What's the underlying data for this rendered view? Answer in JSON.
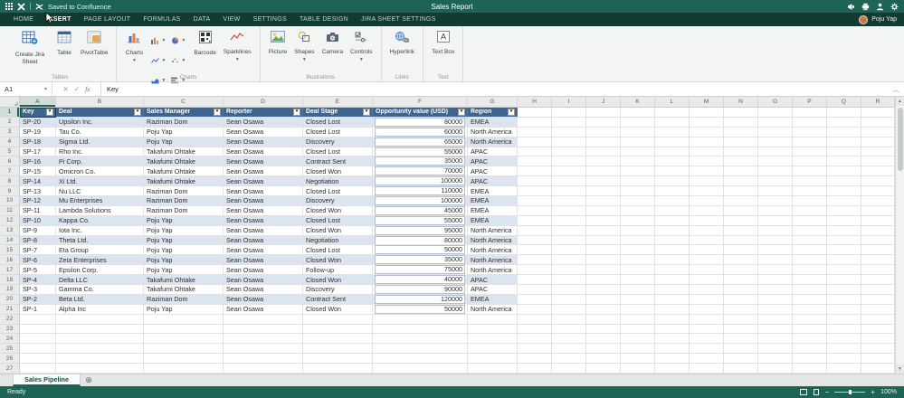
{
  "colors": {
    "chrome": "#1e6455",
    "chrome_dark": "#123b32",
    "table_header": "#3d6591",
    "band_row": "#dbe4ef",
    "grid_header": "#e9ebeb"
  },
  "title_bar": {
    "saved_text": "Saved to Confluence",
    "title": "Sales Report"
  },
  "menu_bar": {
    "items": [
      "HOME",
      "INSERT",
      "PAGE LAYOUT",
      "FORMULAS",
      "DATA",
      "VIEW",
      "SETTINGS",
      "TABLE DESIGN",
      "JIRA SHEET SETTINGS"
    ],
    "active": "INSERT",
    "user": "Poju Yap"
  },
  "ribbon": {
    "tables": {
      "label": "Tables",
      "create_jira_sheet": "Create Jira Sheet",
      "table": "Table",
      "pivottable": "PivotTable"
    },
    "charts": {
      "label": "Charts",
      "charts": "Charts",
      "barcode": "Barcode",
      "sparklines": "Sparklines",
      "mini_chart_buttons": [
        "column-chart",
        "pie-chart",
        "line-chart",
        "scatter-chart",
        "area-chart",
        "bar-chart"
      ]
    },
    "illustrations": {
      "label": "Illustrations",
      "picture": "Picture",
      "shapes": "Shapes",
      "camera": "Camera",
      "controls": "Controls"
    },
    "links": {
      "label": "Links",
      "hyperlink": "Hyperlink"
    },
    "text": {
      "label": "Text",
      "textbox": "Text Box"
    }
  },
  "formula_bar": {
    "cell_ref": "A1",
    "fx_label": "fx",
    "value": "Key"
  },
  "grid": {
    "column_letters": [
      "A",
      "B",
      "C",
      "D",
      "E",
      "F",
      "G",
      "H",
      "I",
      "J",
      "K",
      "L",
      "M",
      "N",
      "O",
      "P",
      "Q",
      "R"
    ],
    "row_count": 27
  },
  "table": {
    "headers": [
      "Key",
      "Deal",
      "Sales Manager",
      "Reporter",
      "Deal Stage",
      "Opportunity value (USD)",
      "Region"
    ],
    "rows": [
      [
        "SP-20",
        "Upsilon Inc.",
        "Raziman Dom",
        "Sean Osawa",
        "Closed Lost",
        "80000",
        "EMEA"
      ],
      [
        "SP-19",
        "Tau Co.",
        "Poju Yap",
        "Sean Osawa",
        "Closed Lost",
        "60000",
        "North America"
      ],
      [
        "SP-18",
        "Sigma Ltd.",
        "Poju Yap",
        "Sean Osawa",
        "Discovery",
        "65000",
        "North America"
      ],
      [
        "SP-17",
        "Rho Inc.",
        "Takafumi Ohtake",
        "Sean Osawa",
        "Closed Lost",
        "55000",
        "APAC"
      ],
      [
        "SP-16",
        "Pi Corp.",
        "Takafumi Ohtake",
        "Sean Osawa",
        "Contract Sent",
        "35000",
        "APAC"
      ],
      [
        "SP-15",
        "Omicron Co.",
        "Takafumi Ohtake",
        "Sean Osawa",
        "Closed Won",
        "70000",
        "APAC"
      ],
      [
        "SP-14",
        "Xi Ltd.",
        "Takafumi Ohtake",
        "Sean Osawa",
        "Negotiation",
        "100000",
        "APAC"
      ],
      [
        "SP-13",
        "Nu LLC",
        "Raziman Dom",
        "Sean Osawa",
        "Closed Lost",
        "110000",
        "EMEA"
      ],
      [
        "SP-12",
        "Mu Enterprises",
        "Raziman Dom",
        "Sean Osawa",
        "Discovery",
        "100000",
        "EMEA"
      ],
      [
        "SP-11",
        "Lambda Solutions",
        "Raziman Dom",
        "Sean Osawa",
        "Closed Won",
        "45000",
        "EMEA"
      ],
      [
        "SP-10",
        "Kappa Co.",
        "Poju Yap",
        "Sean Osawa",
        "Closed Lost",
        "55000",
        "EMEA"
      ],
      [
        "SP-9",
        "Iota Inc.",
        "Poju Yap",
        "Sean Osawa",
        "Closed Won",
        "95000",
        "North America"
      ],
      [
        "SP-8",
        "Theta Ltd.",
        "Poju Yap",
        "Sean Osawa",
        "Negotiation",
        "80000",
        "North America"
      ],
      [
        "SP-7",
        "Eta Group",
        "Poju Yap",
        "Sean Osawa",
        "Closed Lost",
        "50000",
        "North America"
      ],
      [
        "SP-6",
        "Zeta Enterprises",
        "Poju Yap",
        "Sean Osawa",
        "Closed Won",
        "35000",
        "North America"
      ],
      [
        "SP-5",
        "Epsilon Corp.",
        "Poju Yap",
        "Sean Osawa",
        "Follow-up",
        "75000",
        "North America"
      ],
      [
        "SP-4",
        "Delta LLC",
        "Takafumi Ohtake",
        "Sean Osawa",
        "Closed Won",
        "40000",
        "APAC"
      ],
      [
        "SP-3",
        "Gamma Co.",
        "Takafumi Ohtake",
        "Sean Osawa",
        "Discovery",
        "90000",
        "APAC"
      ],
      [
        "SP-2",
        "Beta Ltd.",
        "Raziman Dom",
        "Sean Osawa",
        "Contract Sent",
        "120000",
        "EMEA"
      ],
      [
        "SP-1",
        "Alpha Inc",
        "Poju Yap",
        "Sean Osawa",
        "Closed Won",
        "50000",
        "North America"
      ]
    ]
  },
  "sheet_tabs": {
    "active_tab": "Sales Pipeline"
  },
  "status_bar": {
    "status": "Ready",
    "zoom": "100%"
  }
}
